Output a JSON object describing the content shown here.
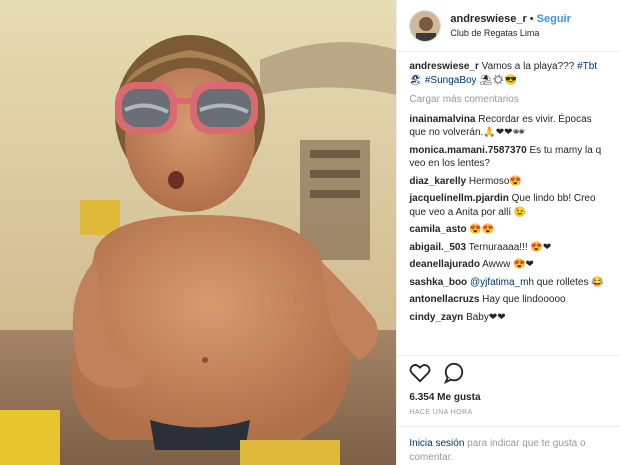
{
  "header": {
    "username": "andreswiese_r",
    "separator": "•",
    "follow_label": "Seguir",
    "location": "Club de Regatas Lima"
  },
  "caption": {
    "username": "andreswiese_r",
    "text": "Vamos a la playa??? ",
    "tag1": "#Tbt🏖",
    "tag2": "#SungaBoy",
    "emoji": " ⛱☀😎"
  },
  "load_more": "Cargar más comentarios",
  "comments": [
    {
      "user": "inainamalvina",
      "text": "Recordar es vivir. Épocas que no volverán.🙏❤❤🕶"
    },
    {
      "user": "monica.mamani.7587370",
      "text": "Es tu mamy la q veo en los lentes?"
    },
    {
      "user": "diaz_karelly",
      "text": "Hermoso😍"
    },
    {
      "user": "jacquelinellm.pjardin",
      "text": "Que lindo bb! Creo que veo a Anita por allí 😉"
    },
    {
      "user": "camila_asto",
      "text": "😍😍"
    },
    {
      "user": "abigail._503",
      "text": "Ternuraaaa!!! 😍❤"
    },
    {
      "user": "deanellajurado",
      "text": "Awww 😍❤"
    },
    {
      "user": "sashka_boo",
      "mention": "@yjfatima_mh",
      "text": " que rolletes 😂"
    },
    {
      "user": "antonellacruzs",
      "text": "Hay que lindooooo"
    },
    {
      "user": "cindy_zayn",
      "text": "Baby❤❤"
    }
  ],
  "likes": "6.354 Me gusta",
  "time": "HACE UNA HORA",
  "login": {
    "link": "Inicia sesión",
    "text": " para indicar que te gusta o comentar."
  },
  "icons": [
    "heart-icon",
    "comment-icon"
  ]
}
